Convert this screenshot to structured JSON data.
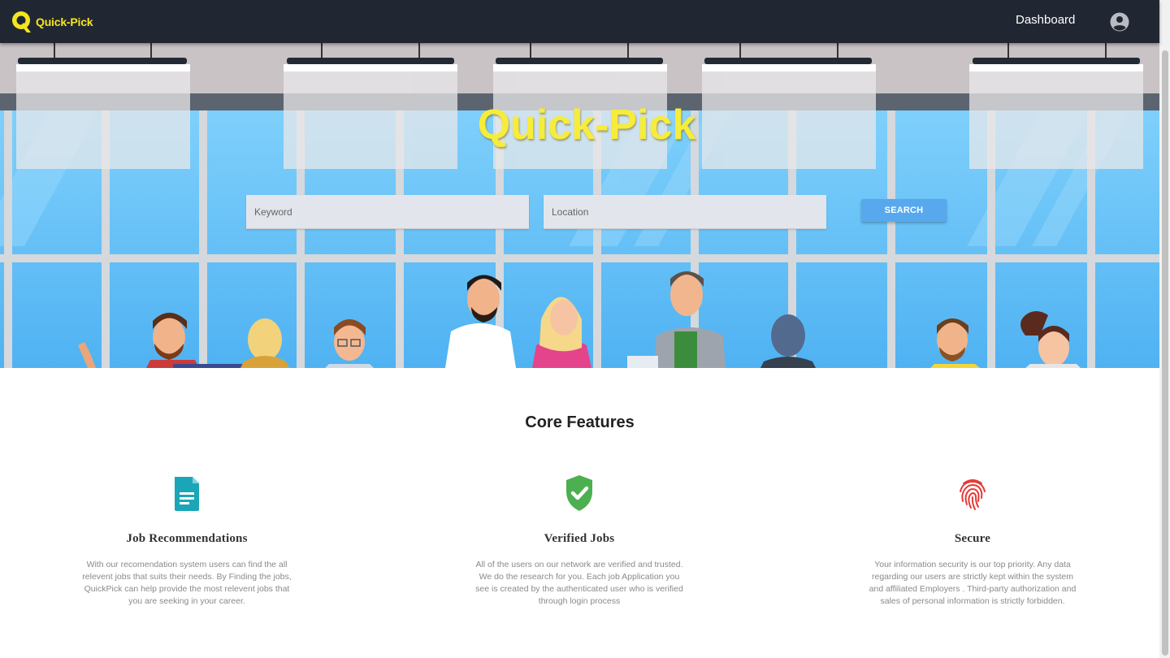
{
  "navbar": {
    "brand": "Quick-Pick",
    "dashboard_label": "Dashboard",
    "account_icon": "account-circle-icon"
  },
  "hero": {
    "title": "Quick-Pick",
    "keyword_placeholder": "Keyword",
    "location_placeholder": "Location",
    "search_label": "SEARCH"
  },
  "features": {
    "title": "Core Features",
    "items": [
      {
        "icon": "document-icon",
        "title": "Job Recommendations",
        "description": "With our recomendation system users can find the all relevent jobs that suits their needs. By Finding the jobs, QuickPick can help provide the most relevent jobs that you are seeking in your career.",
        "color": "#1aa6b7"
      },
      {
        "icon": "verified-shield-icon",
        "title": "Verified Jobs",
        "description": "All of the users on our network are verified and trusted. We do the research for you. Each job Application you see is created by the authenticated user who is verified through login process",
        "color": "#4caf50"
      },
      {
        "icon": "fingerprint-icon",
        "title": "Secure",
        "description": "Your information security is our top priority. Any data regarding our users are strictly kept within the system and affiliated Employers . Third-party authorization and sales of personal information is strictly forbidden.",
        "color": "#e53935"
      }
    ]
  },
  "colors": {
    "navbar": "#212732",
    "brand_yellow": "#f5e51f",
    "search_button": "#58a8ee",
    "sky": "#63bff7"
  }
}
